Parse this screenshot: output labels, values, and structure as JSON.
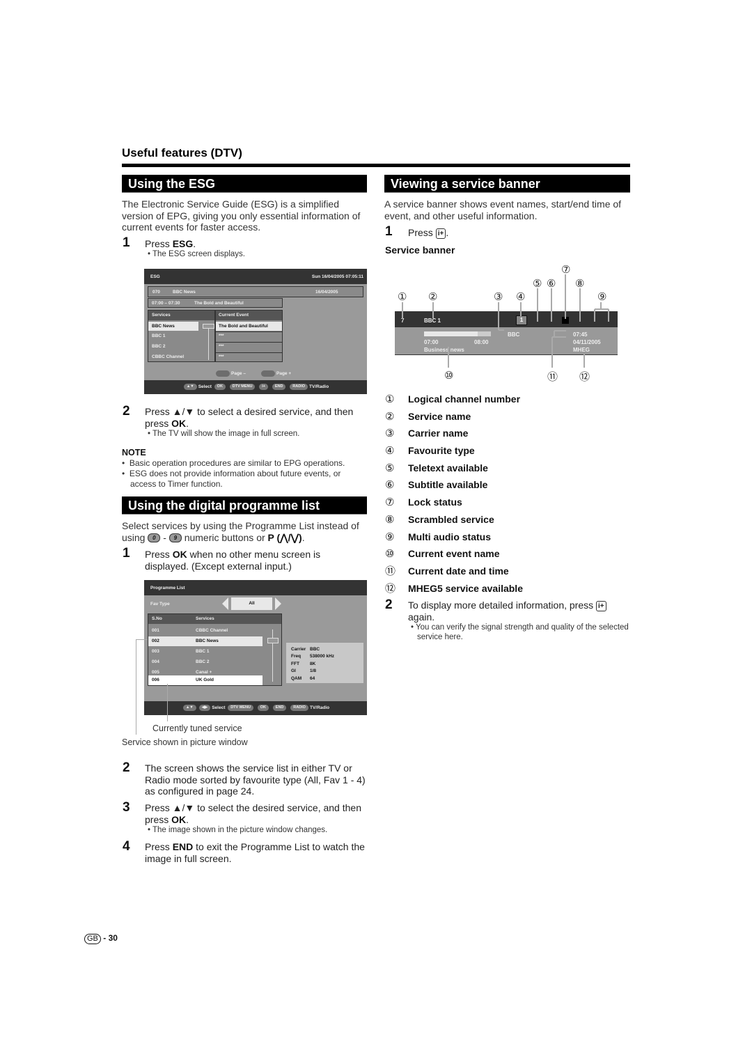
{
  "header": {
    "section": "Useful features (DTV)"
  },
  "esg": {
    "title": "Using the ESG",
    "intro": "The Electronic Service Guide (ESG) is a simplified version of EPG, giving you only essential information of current events for faster access.",
    "step1": {
      "num": "1",
      "pre": "Press ",
      "key": "ESG",
      "post": ".",
      "bullet": "The ESG screen displays."
    },
    "screen": {
      "title": "ESG",
      "datetime": "Sun  16/04/2005  07:05:11",
      "channel_no": "070",
      "channel_name": "BBC News",
      "channel_date": "16/04/2005",
      "event_time": "07:00 – 07:30",
      "event_name": "The Bold and Beautiful",
      "col_services": "Services",
      "col_event": "Current Event",
      "rows": [
        {
          "service": "BBC News",
          "event": "The Bold and Beautiful"
        },
        {
          "service": "BBC 1",
          "event": "***"
        },
        {
          "service": "BBC 2",
          "event": "***"
        },
        {
          "service": "CBBC Channel",
          "event": "***"
        }
      ],
      "page_minus": "Page –",
      "page_plus": "Page +",
      "footer": {
        "select": "Select",
        "ok": "OK",
        "dtv_menu": "DTV MENU",
        "info": "i+",
        "end": "END",
        "radio": "RADIO",
        "tv_radio": "TV/Radio"
      }
    },
    "step2": {
      "num": "2",
      "pre": "Press ▲/▼ to select a desired service, and then press ",
      "key": "OK",
      "post": ".",
      "bullet": "The TV will show the image in full screen."
    },
    "note": {
      "title": "NOTE",
      "items": [
        "Basic operation procedures are similar to EPG operations.",
        "ESG does not provide information about future events, or access to Timer function."
      ]
    }
  },
  "proglist": {
    "title": "Using the digital programme list",
    "intro_pre": "Select services by using the Programme List instead of using ",
    "btn0": "0",
    "dash": " - ",
    "btn9": "9",
    "intro_mid": " numeric buttons or ",
    "intro_key": "P (⋀/⋁)",
    "intro_post": ".",
    "step1": {
      "num": "1",
      "pre": "Press ",
      "key": "OK",
      "post": " when no other menu screen is displayed. (Except external input.)"
    },
    "screen": {
      "title": "Programme List",
      "fav_label": "Fav Type",
      "fav_value": "All",
      "col_sno": "S.No",
      "col_services": "Services",
      "rows": [
        {
          "sno": "001",
          "service": "CBBC Channel"
        },
        {
          "sno": "002",
          "service": "BBC News"
        },
        {
          "sno": "003",
          "service": "BBC 1"
        },
        {
          "sno": "004",
          "service": "BBC 2"
        },
        {
          "sno": "005",
          "service": "Canal +"
        },
        {
          "sno": "006",
          "service": "UK Gold"
        }
      ],
      "info": [
        {
          "k": "Carrier",
          "v": "BBC"
        },
        {
          "k": "Freq",
          "v": "538000 kHz"
        },
        {
          "k": "FFT",
          "v": "8K"
        },
        {
          "k": "GI",
          "v": "1/8"
        },
        {
          "k": "QAM",
          "v": "64"
        }
      ],
      "footer": {
        "select": "Select",
        "dtv_menu": "DTV MENU",
        "ok": "OK",
        "end": "END",
        "radio": "RADIO",
        "tv_radio": "TV/Radio"
      }
    },
    "callout_tuned": "Currently tuned service",
    "callout_picture": "Service shown in picture window",
    "step2": {
      "num": "2",
      "text": "The screen shows the service list in either TV or Radio mode sorted by favourite type (All, Fav 1 - 4) as configured in page 24."
    },
    "step3": {
      "num": "3",
      "pre": "Press ▲/▼ to select the desired service, and then press ",
      "key": "OK",
      "post": ".",
      "bullet": "The image shown in the picture window changes."
    },
    "step4": {
      "num": "4",
      "pre": "Press ",
      "key": "END",
      "post": " to exit the Programme List to watch the image in full screen."
    }
  },
  "banner": {
    "title": "Viewing a service banner",
    "intro": "A service banner shows event names, start/end time of event, and other useful information.",
    "step1": {
      "num": "1",
      "pre": "Press ",
      "key": "i+",
      "post": "."
    },
    "subhead": "Service banner",
    "screen": {
      "channel_no": "7",
      "service": "BBC 1",
      "fav": "1",
      "carrier": "BBC",
      "start": "07:00",
      "end": "08:00",
      "event": "Business news",
      "time": "07:45",
      "date": "04/11/2005",
      "mheg": "MHEG",
      "progress": 0.8
    },
    "callouts": [
      "①",
      "②",
      "③",
      "④",
      "⑤",
      "⑥",
      "⑦",
      "⑧",
      "⑨",
      "⑩",
      "⑪",
      "⑫"
    ],
    "legend": [
      {
        "n": "①",
        "label": "Logical channel number"
      },
      {
        "n": "②",
        "label": "Service name"
      },
      {
        "n": "③",
        "label": "Carrier name"
      },
      {
        "n": "④",
        "label": "Favourite type"
      },
      {
        "n": "⑤",
        "label": "Teletext available"
      },
      {
        "n": "⑥",
        "label": "Subtitle available"
      },
      {
        "n": "⑦",
        "label": "Lock status"
      },
      {
        "n": "⑧",
        "label": "Scrambled service"
      },
      {
        "n": "⑨",
        "label": "Multi audio status"
      },
      {
        "n": "⑩",
        "label": "Current event name"
      },
      {
        "n": "⑪",
        "label": "Current date and time"
      },
      {
        "n": "⑫",
        "label": "MHEG5 service available"
      }
    ],
    "step2": {
      "num": "2",
      "pre": "To display more detailed information, press ",
      "key": "i+",
      "post": " again.",
      "bullet": "You can verify the signal strength and quality of the selected service here."
    }
  },
  "footer": {
    "region": "GB",
    "page": "- 30"
  }
}
